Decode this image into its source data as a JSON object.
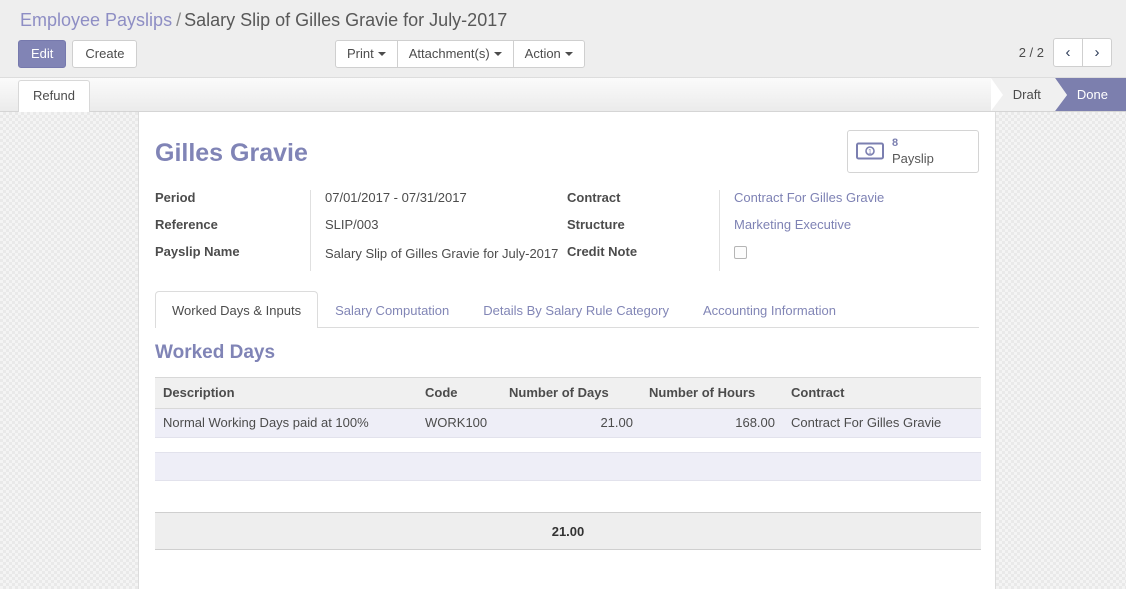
{
  "breadcrumb": {
    "root": "Employee Payslips",
    "separator": "/",
    "current": "Salary Slip of Gilles Gravie for July-2017"
  },
  "control_panel": {
    "edit_label": "Edit",
    "create_label": "Create",
    "print_label": "Print",
    "attachments_label": "Attachment(s)",
    "action_label": "Action",
    "pager_text": "2 / 2",
    "prev_icon": "‹",
    "next_icon": "›"
  },
  "statusbar": {
    "refund_label": "Refund",
    "states": [
      {
        "label": "Draft",
        "active": false
      },
      {
        "label": "Done",
        "active": true
      }
    ]
  },
  "sheet": {
    "title": "Gilles Gravie",
    "stat_button": {
      "icon": "money-icon",
      "value": "8",
      "label": "Payslip"
    },
    "left_fields": [
      {
        "label": "Period",
        "value": "07/01/2017 - 07/31/2017",
        "type": "text"
      },
      {
        "label": "Reference",
        "value": "SLIP/003",
        "type": "text"
      },
      {
        "label": "Payslip Name",
        "value": "Salary Slip of Gilles Gravie for July-2017",
        "type": "text"
      }
    ],
    "right_fields": [
      {
        "label": "Contract",
        "value": "Contract For Gilles Gravie",
        "type": "link"
      },
      {
        "label": "Structure",
        "value": "Marketing Executive",
        "type": "link"
      },
      {
        "label": "Credit Note",
        "value": "",
        "type": "checkbox"
      }
    ]
  },
  "notebook": {
    "tabs": [
      {
        "label": "Worked Days & Inputs",
        "active": true
      },
      {
        "label": "Salary Computation",
        "active": false
      },
      {
        "label": "Details By Salary Rule Category",
        "active": false
      },
      {
        "label": "Accounting Information",
        "active": false
      }
    ]
  },
  "worked_days": {
    "section_title": "Worked Days",
    "columns": [
      "Description",
      "Code",
      "Number of Days",
      "Number of Hours",
      "Contract"
    ],
    "rows": [
      {
        "description": "Normal Working Days paid at 100%",
        "code": "WORK100",
        "number_of_days": "21.00",
        "number_of_hours": "168.00",
        "contract": "Contract For Gilles Gravie"
      }
    ],
    "total_days": "21.00"
  },
  "colors": {
    "accent": "#8084b6",
    "primary_button": "#8184b5",
    "status_active": "#7c7fae",
    "row_background": "#eeeef7"
  }
}
